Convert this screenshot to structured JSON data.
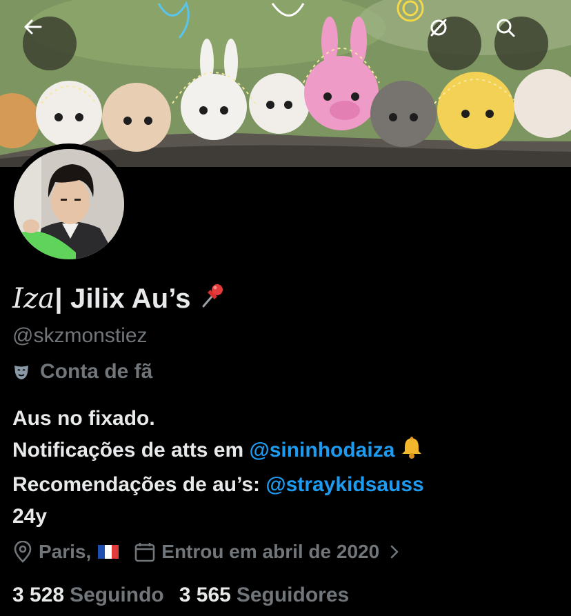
{
  "profile": {
    "name_italic": "Iza",
    "name_rest": " | Jilix Au’s",
    "name_emoji": "pushpin",
    "handle": "@skzmonstiez",
    "category": "Conta de fã",
    "bio": {
      "line1": "Aus no fixado.",
      "line2_prefix": "Notificações de atts em ",
      "line2_mention": "@sininhodaiza",
      "line2_emoji": "bell",
      "line3_prefix": "Recomendações de au’s: ",
      "line3_mention": "@straykidsauss",
      "line4": "24y"
    },
    "location": "Paris,",
    "location_flag": "france-flag",
    "joined": "Entrou em abril de 2020",
    "following_count": "3 528",
    "following_label": "Seguindo",
    "followers_count": "3 565",
    "followers_label": "Seguidores"
  },
  "icons": {
    "back": "arrow-left-icon",
    "sync": "sync-off-icon",
    "search": "search-icon",
    "category": "theater-mask-icon",
    "location": "location-pin-icon",
    "calendar": "calendar-icon",
    "chevron": "chevron-right-icon"
  },
  "colors": {
    "background": "#000000",
    "text": "#e7e9ea",
    "muted": "#71767b",
    "link": "#1d9bf0"
  }
}
